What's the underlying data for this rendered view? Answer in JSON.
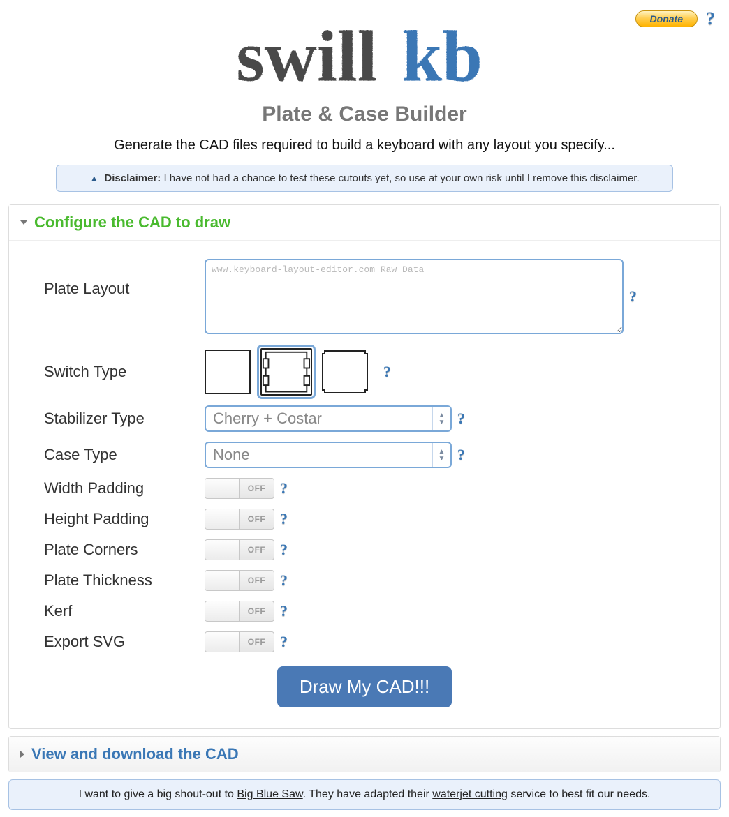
{
  "top": {
    "donate_label": "Donate"
  },
  "header": {
    "logo_part1": "swill",
    "logo_part2": "kb",
    "subtitle": "Plate & Case Builder",
    "tagline": "Generate the CAD files required to build a keyboard with any layout you specify..."
  },
  "disclaimer": {
    "label": "Disclaimer:",
    "text": " I have not had a chance to test these cutouts yet, so use at your own risk until I remove this disclaimer."
  },
  "sections": {
    "configure_title": "Configure the CAD to draw",
    "download_title": "View and download the CAD"
  },
  "form": {
    "plate_layout_label": "Plate Layout",
    "plate_layout_placeholder": "www.keyboard-layout-editor.com Raw Data",
    "switch_type_label": "Switch Type",
    "stabilizer_type_label": "Stabilizer Type",
    "stabilizer_type_value": "Cherry + Costar",
    "case_type_label": "Case Type",
    "case_type_value": "None",
    "width_padding_label": "Width Padding",
    "height_padding_label": "Height Padding",
    "plate_corners_label": "Plate Corners",
    "plate_thickness_label": "Plate Thickness",
    "kerf_label": "Kerf",
    "export_svg_label": "Export SVG",
    "toggle_off": "OFF",
    "draw_button": "Draw My CAD!!!"
  },
  "footer": {
    "pre": "I want to give a big shout-out to ",
    "link1": "Big Blue Saw",
    "mid": ".  They have adapted their ",
    "link2": "waterjet cutting",
    "post": " service to best fit our needs."
  }
}
